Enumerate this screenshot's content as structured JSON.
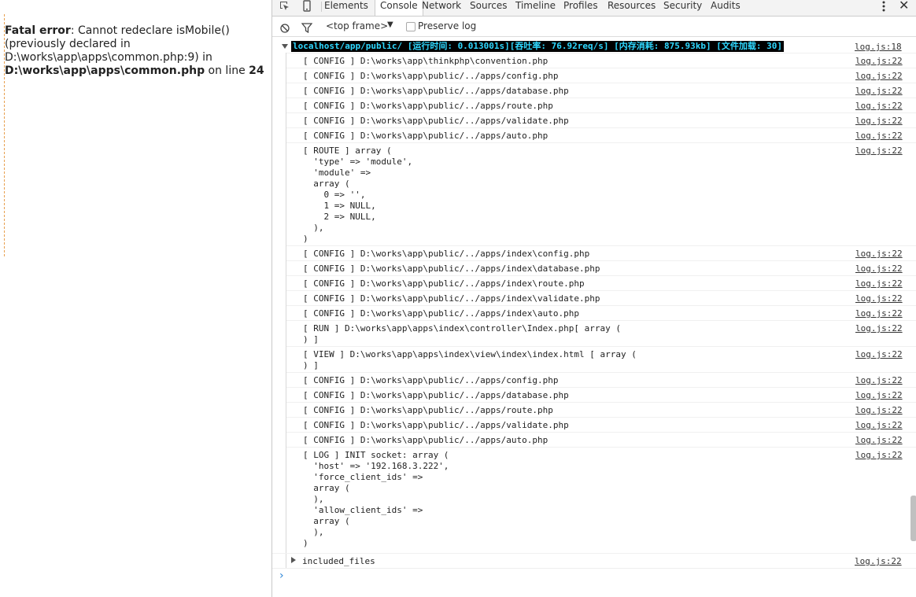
{
  "page": {
    "error_label": "Fatal error",
    "error_text": ": Cannot redeclare isMobile() (previously declared in D:\\works\\app\\apps\\common.php:9) in ",
    "error_file": "D:\\works\\app\\apps\\common.php",
    "error_mid": " on line ",
    "error_line": "24"
  },
  "devtools": {
    "tabs": [
      "Elements",
      "Console",
      "Network",
      "Sources",
      "Timeline",
      "Profiles",
      "Resources",
      "Security",
      "Audits"
    ],
    "active_tab": "Console",
    "frame_select": "<top frame>",
    "preserve_log_label": "Preserve log",
    "preserve_log_checked": false
  },
  "console": {
    "group_header": "localhost/app/public/ [运行时间: 0.013001s][吞吐率: 76.92req/s] [内存消耗: 875.93kb] [文件加载: 30]",
    "group_header_source": "log.js:18",
    "messages": [
      {
        "text": "[ CONFIG ] D:\\works\\app\\thinkphp\\convention.php",
        "source": "log.js:22"
      },
      {
        "text": "[ CONFIG ] D:\\works\\app\\public/../apps/config.php",
        "source": "log.js:22"
      },
      {
        "text": "[ CONFIG ] D:\\works\\app\\public/../apps/database.php",
        "source": "log.js:22"
      },
      {
        "text": "[ CONFIG ] D:\\works\\app\\public/../apps/route.php",
        "source": "log.js:22"
      },
      {
        "text": "[ CONFIG ] D:\\works\\app\\public/../apps/validate.php",
        "source": "log.js:22"
      },
      {
        "text": "[ CONFIG ] D:\\works\\app\\public/../apps/auto.php",
        "source": "log.js:22"
      },
      {
        "text": "[ ROUTE ] array (\n  'type' => 'module',\n  'module' =>\n  array (\n    0 => '',\n    1 => NULL,\n    2 => NULL,\n  ),\n)",
        "source": "log.js:22"
      },
      {
        "text": "[ CONFIG ] D:\\works\\app\\public/../apps/index\\config.php",
        "source": "log.js:22"
      },
      {
        "text": "[ CONFIG ] D:\\works\\app\\public/../apps/index\\database.php",
        "source": "log.js:22"
      },
      {
        "text": "[ CONFIG ] D:\\works\\app\\public/../apps/index\\route.php",
        "source": "log.js:22"
      },
      {
        "text": "[ CONFIG ] D:\\works\\app\\public/../apps/index\\validate.php",
        "source": "log.js:22"
      },
      {
        "text": "[ CONFIG ] D:\\works\\app\\public/../apps/index\\auto.php",
        "source": "log.js:22"
      },
      {
        "text": "[ RUN ] D:\\works\\app\\apps\\index\\controller\\Index.php[ array (\n) ]",
        "source": "log.js:22"
      },
      {
        "text": "[ VIEW ] D:\\works\\app\\apps\\index\\view\\index\\index.html [ array (\n) ]",
        "source": "log.js:22"
      },
      {
        "text": "[ CONFIG ] D:\\works\\app\\public/../apps/config.php",
        "source": "log.js:22"
      },
      {
        "text": "[ CONFIG ] D:\\works\\app\\public/../apps/database.php",
        "source": "log.js:22"
      },
      {
        "text": "[ CONFIG ] D:\\works\\app\\public/../apps/route.php",
        "source": "log.js:22"
      },
      {
        "text": "[ CONFIG ] D:\\works\\app\\public/../apps/validate.php",
        "source": "log.js:22"
      },
      {
        "text": "[ CONFIG ] D:\\works\\app\\public/../apps/auto.php",
        "source": "log.js:22"
      },
      {
        "text": "[ LOG ] INIT socket: array (\n  'host' => '192.168.3.222',\n  'force_client_ids' =>\n  array (\n  ),\n  'allow_client_ids' =>\n  array (\n  ),\n)",
        "source": "log.js:22"
      }
    ],
    "collapsed_group": {
      "label": "included_files",
      "source": "log.js:22"
    },
    "prompt_symbol": "›"
  }
}
